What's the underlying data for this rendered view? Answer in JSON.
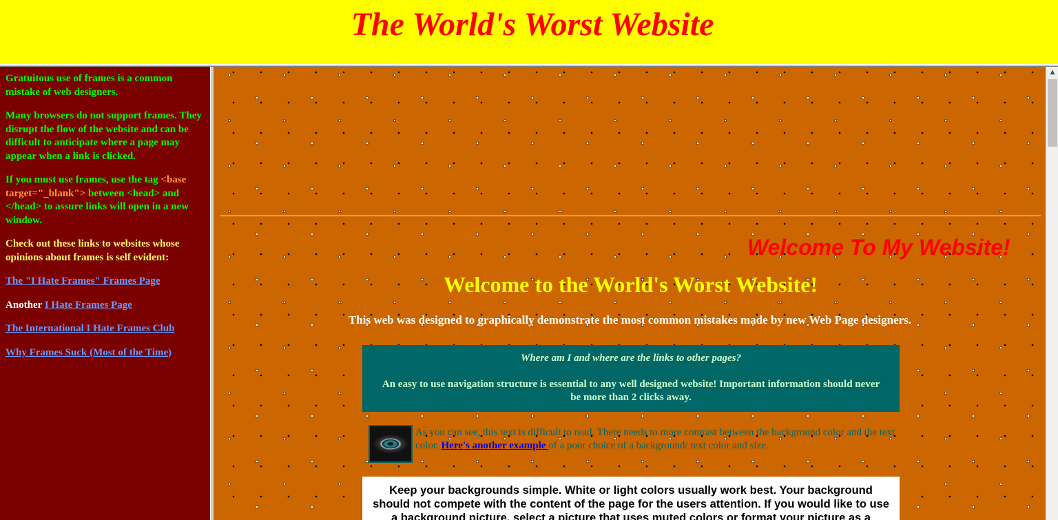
{
  "top": {
    "title": "The World's Worst Website"
  },
  "left": {
    "p1": "Gratuitous use of frames is a common mistake of web designers.",
    "p2": "Many browsers do not support frames. They disrupt the flow of the website and can be difficult to anticipate where a page may appear when a link is clicked.",
    "p3_before": "If you must use frames, use the tag ",
    "p3_tag": "<base target=\"_blank\">",
    "p3_middle": " between ",
    "p3_tag2": "<head> and </head>",
    "p3_after": " to assure links will open in a new window.",
    "p4": "Check out these links to websites whose opinions about frames is self evident:",
    "link1": "The \"I Hate Frames\" Frames Page",
    "link2_prefix": "Another ",
    "link2": "I Hate Frames Page",
    "link3": "The International I Hate Frames Club",
    "link4": "Why Frames Suck (Most of the Time)"
  },
  "main": {
    "marquee": "Welcome To My Website!",
    "heading": "Welcome to the World's Worst Website!",
    "intro": "This web was designed to graphically demonstrate the most common mistakes made by new Web Page designers.",
    "nav_question": "Where am I and where are the links to other pages?",
    "nav_text": "An easy to use navigation structure is essential to any well designed website! Important information should never be more than 2 clicks away.",
    "contrast_before": "As you can see, this text is difficult to read. There needs to more contrast between the background color and the text color. ",
    "contrast_link": "Here's another example ",
    "contrast_after": "of a poor choice of a background/ text color and size.",
    "background_text": "Keep your backgrounds simple. White or light colors usually work best. Your background should not compete with the content of the page for the users attention. If you would like to use a background picture, select a picture that uses muted colors or format your picture as a watermark."
  },
  "colors": {
    "top_bg": "#ffff00",
    "title_color": "#ff0000",
    "left_bg": "#7b0000",
    "main_bg": "#cc6600",
    "nav_box_bg": "#006666"
  }
}
